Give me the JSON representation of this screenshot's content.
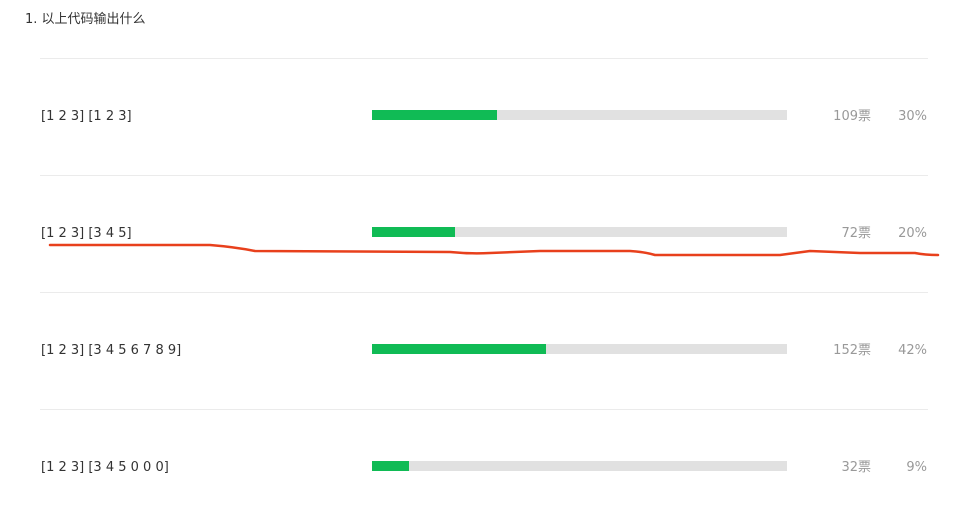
{
  "question": {
    "title": "1. 以上代码输出什么"
  },
  "options": [
    {
      "label": "[1 2 3] [1 2 3]",
      "votes": "109票",
      "percent": "30%",
      "fill": 0.3
    },
    {
      "label": "[1 2 3] [3 4 5]",
      "votes": "72票",
      "percent": "20%",
      "fill": 0.2
    },
    {
      "label": "[1 2 3] [3 4 5 6 7 8 9]",
      "votes": "152票",
      "percent": "42%",
      "fill": 0.42
    },
    {
      "label": "[1 2 3] [3 4 5 0 0 0]",
      "votes": "32票",
      "percent": "9%",
      "fill": 0.09
    }
  ],
  "colors": {
    "bar_fill": "#10bb55",
    "bar_track": "#e1e1e1",
    "annotation_stroke": "#e8401c"
  }
}
